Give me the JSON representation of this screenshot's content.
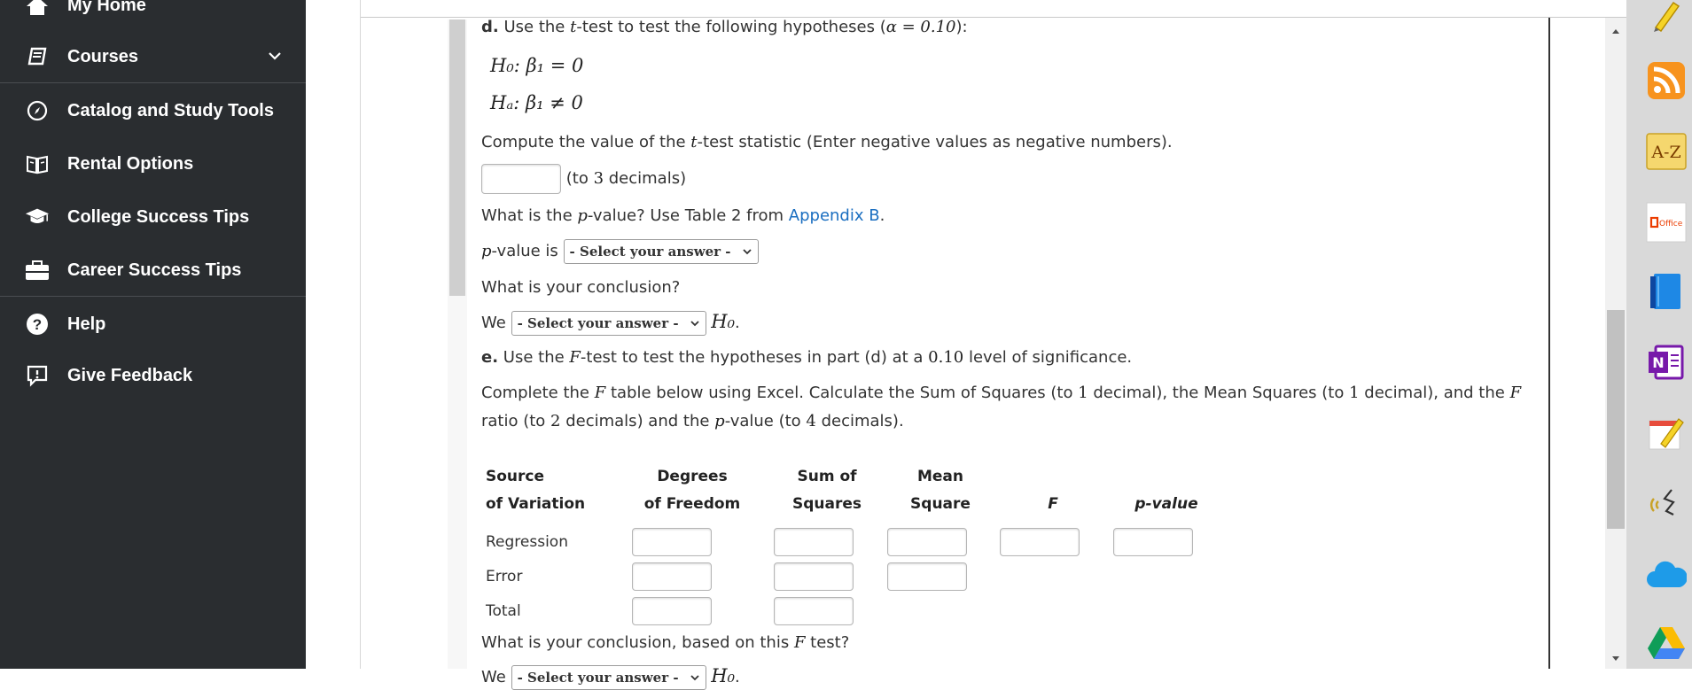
{
  "sidebar": {
    "items": [
      {
        "label": "My Home",
        "icon": "home-icon"
      },
      {
        "label": "Courses",
        "icon": "book-icon"
      },
      {
        "label": "Catalog and Study Tools",
        "icon": "compass-icon"
      },
      {
        "label": "Rental Options",
        "icon": "open-book-icon"
      },
      {
        "label": "College Success Tips",
        "icon": "graduation-cap-icon"
      },
      {
        "label": "Career Success Tips",
        "icon": "briefcase-icon"
      },
      {
        "label": "Help",
        "icon": "help-icon"
      },
      {
        "label": "Give Feedback",
        "icon": "feedback-icon"
      }
    ]
  },
  "question": {
    "part_d_label": "d.",
    "part_d_text_1": "Use the ",
    "part_d_t": "t",
    "part_d_text_2": "-test to test the following hypotheses (",
    "part_d_alpha": "α = 0.10",
    "part_d_text_3": "):",
    "h0": "H₀: β₁ = 0",
    "ha": "Hₐ: β₁ ≠ 0",
    "compute_text_1": "Compute the value of the ",
    "compute_t": "t",
    "compute_text_2": "-test statistic (Enter negative values as negative numbers).",
    "to_decimals_prefix": "(to ",
    "to_decimals_num": "3",
    "to_decimals_suffix": " decimals)",
    "pvalue_q_1": "What is the ",
    "pvalue_q_p": "p",
    "pvalue_q_2": "-value? Use Table 2 from ",
    "appendix_link": "Appendix B",
    "pvalue_q_end": ".",
    "pvalue_is_p": "p",
    "pvalue_is": "-value is",
    "select_placeholder": "- Select your answer -",
    "conclusion_q": "What is your conclusion?",
    "we": "We",
    "h0_short": "H₀",
    "period": ".",
    "part_e_label": "e.",
    "part_e_text_1": "Use the ",
    "part_e_F": "F",
    "part_e_text_2": "-test to test the hypotheses in part (d) at a ",
    "part_e_level": "0.10",
    "part_e_text_3": " level of significance.",
    "complete_1": "Complete the ",
    "complete_F": "F",
    "complete_2": " table below using Excel. Calculate the Sum of Squares (to ",
    "complete_n1": "1",
    "complete_3": " decimal), the Mean Squares (to ",
    "complete_n2": "1",
    "complete_4": " decimal), and the ",
    "complete_F2": "F",
    "complete_5": "ratio (to ",
    "complete_n3": "2",
    "complete_6": " decimals) and the ",
    "complete_p": "p",
    "complete_7": "-value (to ",
    "complete_n4": "4",
    "complete_8": " decimals).",
    "final_q_1": "What is your conclusion, based on this ",
    "final_q_F": "F",
    "final_q_2": " test?"
  },
  "anova_table": {
    "headers": [
      {
        "line1": "Source",
        "line2": "of Variation"
      },
      {
        "line1": "Degrees",
        "line2": "of Freedom"
      },
      {
        "line1": "Sum of",
        "line2": "Squares"
      },
      {
        "line1": "Mean",
        "line2": "Square"
      },
      {
        "line1": "",
        "line2": "F"
      },
      {
        "line1": "",
        "line2": "p-value"
      }
    ],
    "rows": [
      "Regression",
      "Error",
      "Total"
    ]
  },
  "colors": {
    "sidebar_bg": "#2a2d30",
    "link": "#1a6ec0"
  }
}
